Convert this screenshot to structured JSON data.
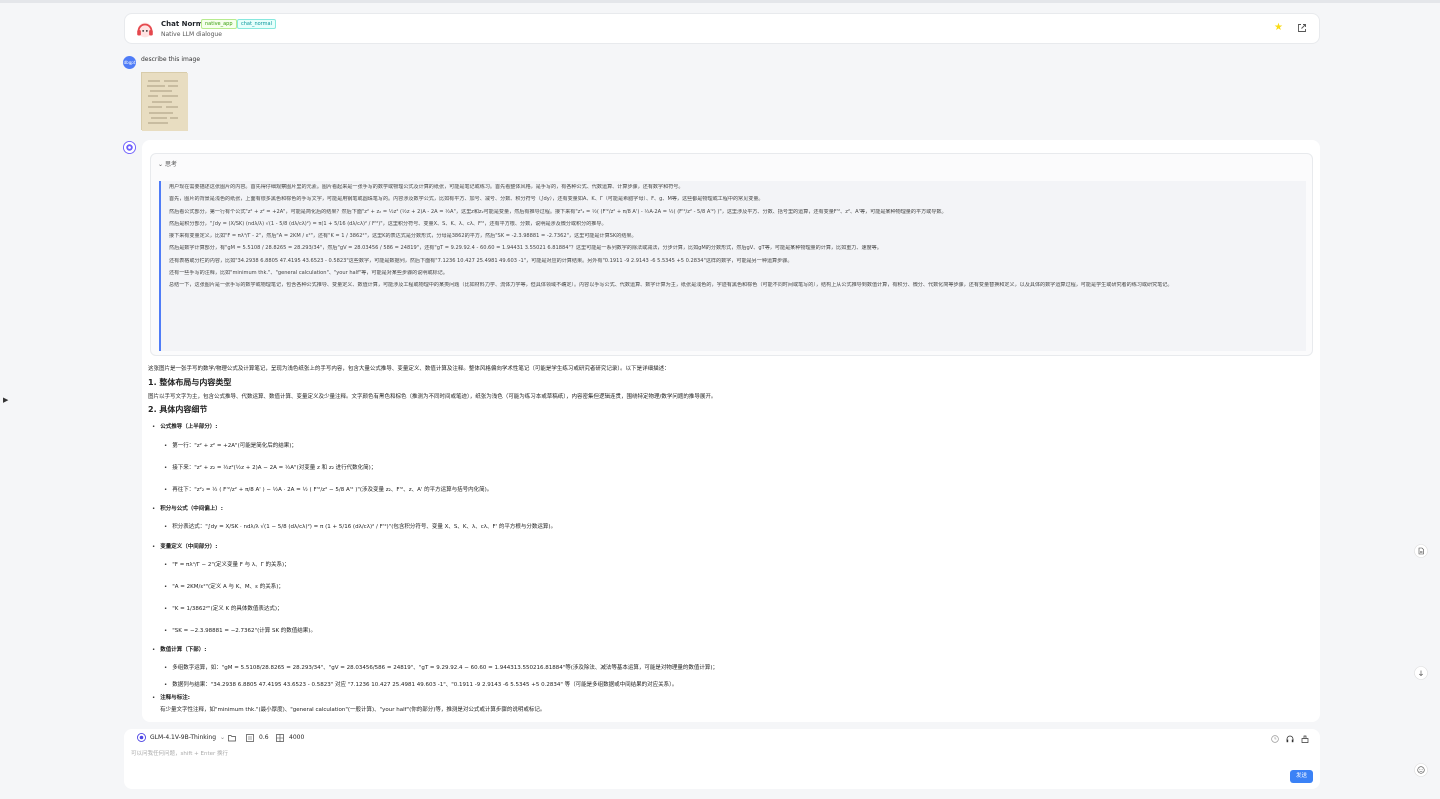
{
  "header": {
    "title": "Chat Normal",
    "tags": [
      "native_app",
      "chat_normal"
    ],
    "subtitle": "Native LLM dialogue"
  },
  "user": {
    "avatar_text": "dbgpt",
    "message": "describe this image"
  },
  "think": {
    "label": "思考",
    "paragraphs": [
      "用户现在需要描述这张图片的内容。首先得仔细观察图片里的元素。图片看起来是一张手写的数学或物理公式及计算的纸张，可能是笔记或练习。首先看整体风格，是手写的，有各种公式、代数运算、计算步骤，还有数字和符号。",
      "首先，图片的背景是浅色的纸张，上面有很多黑色和棕色的手写文字，可能是用钢笔或圆珠笔写的。内容涉及数学公式，比如有平方、加号、减号、分数、积分符号（∫dy），还有变量如A、K、Γ（可能是希腊字母）、F、g、M等，这些都是物理或工程中的常见变量。",
      "然后看公式部分，第一行有个公式\"z² + z² = +2A\"，可能是简化后的结果？然后下面\"z² + z₂ = ½z² (½z + 2)A - 2A = ½A\"，这里z和z₂可能是变量，然后有推导过程。接下来有\"z²₂ = ½( (F'²/z² + π/8 A') - ½A·2A = ½( (F'²/z² - 5/8 A'²) )\"，这里涉及平方、分数、括号里的运算，还有变量F'²、z²、A'等，可能是某种物理量的平方或导数。",
      "然后是积分部分，\"∫dy = (X/SK) (ndλ/λ) √(1 - 5/8 (dλ/cλ)²) = π(1 + 5/16 (dλ/cλ)² / F'²)\"，这里积分符号、变量X、S、K、λ、cλ、F'²，还有平方根、分数，说明是涉及微分或积分的推导。",
      "接下来有变量定义，比如\"F = πλ⁴/Γ - 2\"，然后\"A = 2KM / ε²\"，还有\"K = 1 / 3862²\"，这里K的表达式是分数形式，分母是3862的平方，然后\"SK = -2.3.98881 = -2.7362\"，这里可能是计算SK的结果。",
      "然后是数字计算部分，有\"gM = 5.5108 / 28.8265 = 28.293/34\"，然后\"gV = 28.03456 / 586 = 24819\"，还有\"gT = 9.29.92.4 - 60.60 = 1.94431 3.55021 6.81884\"？这里可能是一系列数字的除法或减法，分步计算，比如gM的分数形式，然后gV、gT等，可能是某种物理量的计算，比如重力、速度等。",
      "还有表格或分栏的内容，比如\"34.2938 6.8805 47.4195 43.6523 - 0.5823\"这些数字，可能是数据列，然后下面有\"7.1236 10.427 25.4981 49.603 -1\"，可能是对应的计算结果。另外有\"0.1911 -9 2.9143 -6 5.5345 +5 0.2834\"这样的数字，可能是另一种运算步骤。",
      "还有一些手写的注释，比如\"minimum thk.\"、\"general calculation\"、\"your half\"等，可能是对某些步骤的说明或标记。",
      "总结一下，这张图片是一张手写的数学或物理笔记，包含各种公式推导、变量定义、数值计算，可能涉及工程或物理中的某类问题（比如材料力学、流体力学等，但具体领域不确定）。内容以手写公式、代数运算、数字计算为主，纸张是浅色的，字迹有黑色和棕色（可能不同时间或笔写的），结构上从公式推导到数值计算，有积分、微分、代数化简等步骤，还有变量替换和定义，以及具体的数字运算过程，可能是学生或研究者的练习或研究笔记。"
    ]
  },
  "content": {
    "intro": "这张图片是一张手写的数学/物理公式及计算笔记，呈现为浅色纸张上的手写内容，包含大量公式推导、变量定义、数值计算及注释。整体风格偏向学术性笔记（可能是学生练习或研究者研究记录）。以下是详细描述：",
    "h1": "1. 整体布局与内容类型",
    "p1": "图片以手写文字为主，包含公式推导、代数运算、数值计算、变量定义及少量注释。文字颜色有黑色和棕色（推测为不同时间或笔迹），纸张为浅色（可能为练习本或草稿纸），内容密集但逻辑连贯，围绕特定物理/数学问题的推导展开。",
    "h2": "2. 具体内容细节",
    "s1": "公式推导（上半部分）:",
    "s1_items": [
      "第一行：\"z² + z² = +2A\"(可能是简化后的结果)；",
      "接下来：\"z² + z₂ = ½z²(½z + 2)A − 2A = ½A\"(对变量 z 和 z₂ 进行代数化简)；",
      "再往下：\"z²₂ = ½ ( F'²/z² + π/8 A' ) − ½A · 2A = ½ ( F'²/z² − 5/8 A'² )\"(涉及变量 z₂、F'²、z、A' 的平方运算与括号内化简)。"
    ],
    "s2": "积分与公式（中间偏上）:",
    "s2_items": [
      "积分表达式：\"∫dy = X/SK · ndλ/λ √(1 − 5/8 (dλ/cλ)²) = π (1 + 5/16 (dλ/cλ)² / F'²)\"(包含积分符号、变量 X、S、K、λ、cλ、F' 的平方根与分数运算)。"
    ],
    "s3": "变量定义（中间部分）:",
    "s3_items": [
      "\"F = πλ⁴/Γ − 2\"(定义变量 F 与 λ、Γ 的关系)；",
      "\"A = 2KM/ε²\"(定义 A 与 K、M、ε 的关系)；",
      "\"K = 1/3862²\"(定义 K 的具体数值表达式)；",
      "\"SK = −2.3.98881 = −2.7362\"(计算 SK 的数值结果)。"
    ],
    "s4": "数值计算（下部）:",
    "s4_items": [
      "多组数字运算，如：\"gM = 5.5108/28.8265 = 28.293/34\"、\"gV = 28.03456/586 = 24819\"、\"gT = 9.29.92.4 − 60.60 = 1.944313.550216.81884\"等(涉及除法、减法等基本运算，可能是对物理量的数值计算)；",
      "数据列与结果：\"34.2938 6.8805 47.4195 43.6523 - 0.5823\" 对应 \"7.1236 10.427 25.4981 49.603 -1\"、\"0.1911 -9 2.9143 -6 5.5345 +5 0.2834\" 等（可能是多组数据或中间结果的对应关系）。"
    ],
    "s5": "注释与标注:",
    "p5": "有少量文字性注释，如\"minimum thk.\"(最小厚度)、\"general calculation\"(一般计算)、\"your half\"(你的部分)等，推测是对公式或计算步骤的说明或标记。"
  },
  "composer": {
    "model": "GLM-4.1V-9B-Thinking",
    "temperature": "0.6",
    "max_tokens": "4000",
    "placeholder": "可以问我任何问题，shift + Enter 换行",
    "send_label": "发送"
  },
  "colors": {
    "accent": "#3b82f6",
    "star": "#fadb14",
    "think_border": "#4f7cf7"
  }
}
